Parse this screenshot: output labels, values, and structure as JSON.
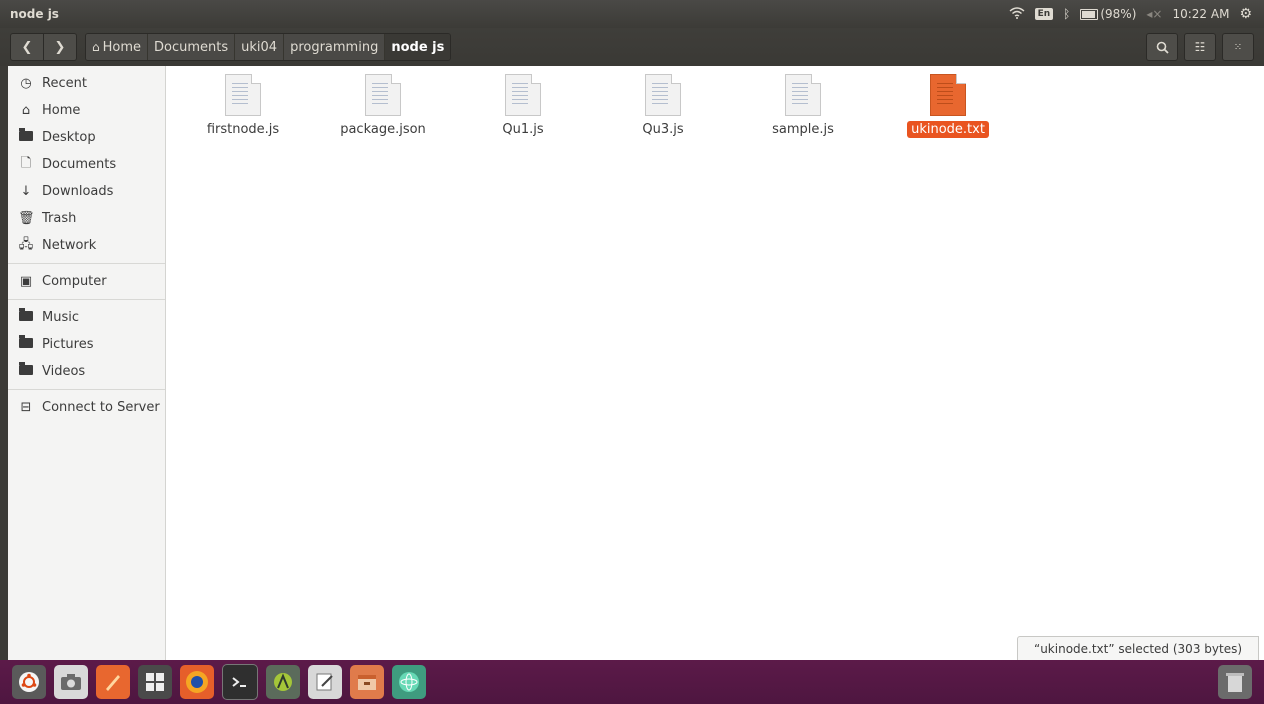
{
  "window": {
    "title": "node js"
  },
  "panel": {
    "keyboard_layout": "En",
    "battery_text": "(98%)",
    "clock": "10:22 AM"
  },
  "toolbar": {
    "back_icon": "chevron-left-icon",
    "forward_icon": "chevron-right-icon",
    "breadcrumbs": [
      "Home",
      "Documents",
      "uki04",
      "programming",
      "node js"
    ],
    "search_icon": "search-icon",
    "list_view_icon": "list-view-icon",
    "grid_menu_icon": "grid-menu-icon"
  },
  "sidebar": {
    "items": [
      {
        "label": "Recent",
        "icon": "clock-icon"
      },
      {
        "label": "Home",
        "icon": "home-icon"
      },
      {
        "label": "Desktop",
        "icon": "folder-icon"
      },
      {
        "label": "Documents",
        "icon": "document-icon"
      },
      {
        "label": "Downloads",
        "icon": "download-icon"
      },
      {
        "label": "Trash",
        "icon": "trash-icon"
      },
      {
        "label": "Network",
        "icon": "network-icon"
      },
      {
        "label": "Computer",
        "icon": "computer-icon"
      },
      {
        "label": "Music",
        "icon": "folder-icon"
      },
      {
        "label": "Pictures",
        "icon": "folder-icon"
      },
      {
        "label": "Videos",
        "icon": "folder-icon"
      },
      {
        "label": "Connect to Server",
        "icon": "server-icon"
      }
    ]
  },
  "files": [
    {
      "name": "firstnode.js",
      "selected": false
    },
    {
      "name": "package.json",
      "selected": false
    },
    {
      "name": "Qu1.js",
      "selected": false
    },
    {
      "name": "Qu3.js",
      "selected": false
    },
    {
      "name": "sample.js",
      "selected": false
    },
    {
      "name": "ukinode.txt",
      "selected": true
    }
  ],
  "status": {
    "text": "“ukinode.txt” selected  (303 bytes)"
  },
  "dock": {
    "items": [
      "ubuntu-dash-icon",
      "camera-icon",
      "inkscape-icon",
      "app-grid-icon",
      "firefox-icon",
      "terminal-icon",
      "android-studio-icon",
      "text-editor-icon",
      "archive-manager-icon",
      "atom-icon"
    ],
    "trash_icon": "dock-trash-icon"
  },
  "colors": {
    "accent": "#e95420",
    "panel": "#3c3b37",
    "dock": "#5c1a49"
  }
}
